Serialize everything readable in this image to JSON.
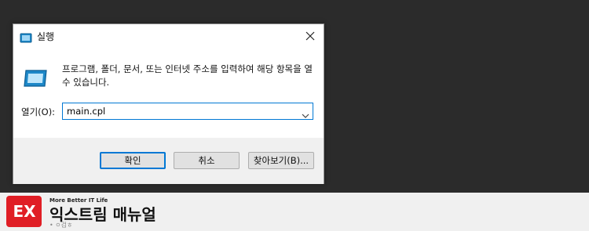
{
  "dialog": {
    "title": "실행",
    "description": "프로그램, 폴더, 문서, 또는 인터넷 주소를 입력하여 해당 항목을 열 수 있습니다.",
    "open_label": "열기(O):",
    "input_value": "main.cpl",
    "buttons": {
      "ok": "확인",
      "cancel": "취소",
      "browse": "찾아보기(B)..."
    }
  },
  "brand": {
    "tagline": "More Better IT Life",
    "name": "익스트림 매뉴얼",
    "sub": "• ㅇ검ㅎ",
    "logo_text": "EX",
    "accent": "#e01e25"
  },
  "colors": {
    "focus": "#0078d4",
    "background": "#2b2b2b"
  }
}
